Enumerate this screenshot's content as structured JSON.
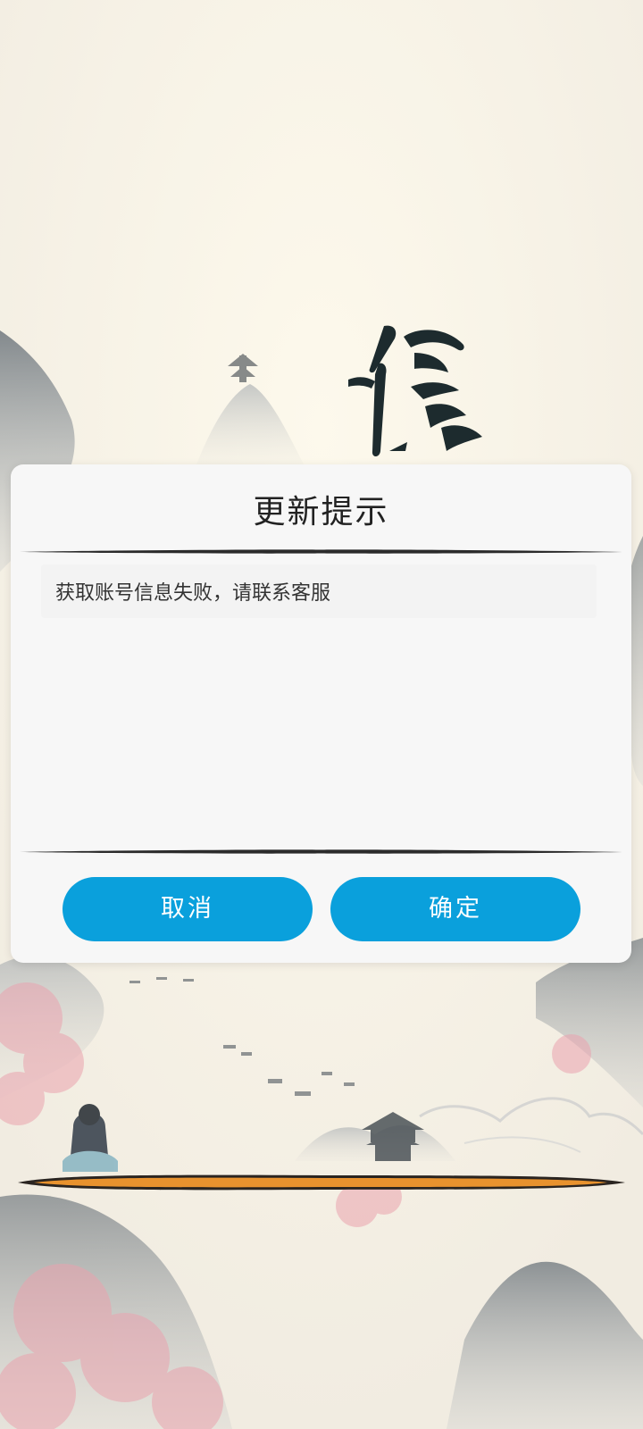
{
  "dialog": {
    "title": "更新提示",
    "message": "获取账号信息失败，请联系客服",
    "cancel_label": "取消",
    "confirm_label": "确定"
  },
  "background": {
    "theme": "ink-wash-landscape",
    "logo_icon": "calligraphy-logo-icon",
    "character_icon": "seated-character-icon",
    "pagoda_icon": "pagoda-icon"
  },
  "loading": {
    "progress_color": "#e8922e"
  },
  "colors": {
    "button": "#0aa0dc",
    "dialog_bg": "#f7f7f7",
    "title_text": "#222222",
    "message_text": "#333333"
  }
}
